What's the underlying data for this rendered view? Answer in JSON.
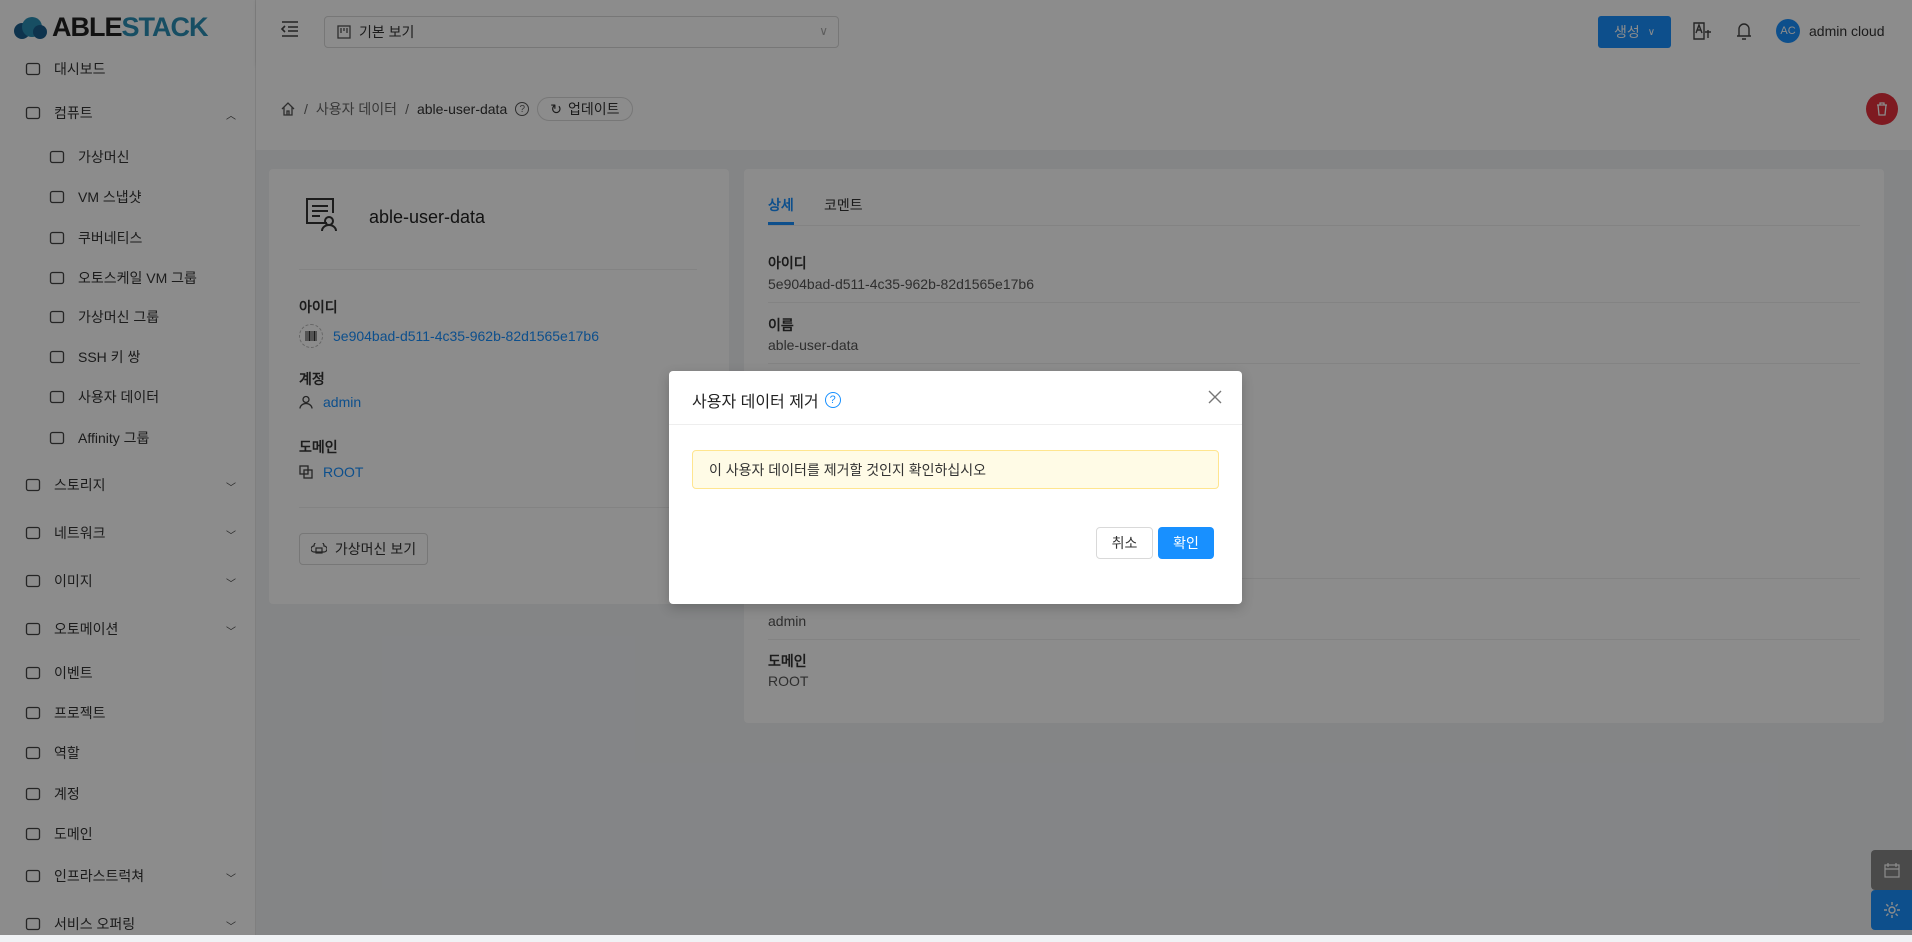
{
  "app": {
    "logo_dark": "ABLE",
    "logo_light": "STACK"
  },
  "header": {
    "view_select": "기본 보기",
    "create_label": "생성",
    "avatar_initials": "AC",
    "user_name": "admin cloud"
  },
  "sidebar": {
    "items": [
      {
        "label": "대시보드",
        "icon": "dashboard-icon"
      },
      {
        "label": "컴퓨트",
        "icon": "cloud-icon",
        "expanded": true
      },
      {
        "label": "가상머신",
        "icon": "vm-icon",
        "sub": true
      },
      {
        "label": "VM 스냅샷",
        "icon": "camera-icon",
        "sub": true
      },
      {
        "label": "쿠버네티스",
        "icon": "kubernetes-icon",
        "sub": true
      },
      {
        "label": "오토스케일 VM 그룹",
        "icon": "autoscale-icon",
        "sub": true
      },
      {
        "label": "가상머신 그룹",
        "icon": "cluster-icon",
        "sub": true
      },
      {
        "label": "SSH 키 쌍",
        "icon": "key-icon",
        "sub": true
      },
      {
        "label": "사용자 데이터",
        "icon": "userdata-icon",
        "sub": true
      },
      {
        "label": "Affinity 그룹",
        "icon": "swap-icon",
        "sub": true
      },
      {
        "label": "스토리지",
        "icon": "storage-icon"
      },
      {
        "label": "네트워크",
        "icon": "wifi-icon"
      },
      {
        "label": "이미지",
        "icon": "image-icon"
      },
      {
        "label": "오토메이션",
        "icon": "automation-icon"
      },
      {
        "label": "이벤트",
        "icon": "event-icon"
      },
      {
        "label": "프로젝트",
        "icon": "project-icon"
      },
      {
        "label": "역할",
        "icon": "role-icon"
      },
      {
        "label": "계정",
        "icon": "account-icon"
      },
      {
        "label": "도메인",
        "icon": "domain-icon"
      },
      {
        "label": "인프라스트럭쳐",
        "icon": "bank-icon"
      },
      {
        "label": "서비스 오퍼링",
        "icon": "shop-icon"
      }
    ]
  },
  "breadcrumb": {
    "section": "사용자 데이터",
    "current": "able-user-data",
    "update_label": "업데이트"
  },
  "left_card": {
    "title": "able-user-data",
    "id_label": "아이디",
    "id_value": "5e904bad-d511-4c35-962b-82d1565e17b6",
    "account_label": "계정",
    "account_value": "admin",
    "domain_label": "도메인",
    "domain_value": "ROOT",
    "view_vm_label": "가상머신 보기"
  },
  "right_card": {
    "tabs": [
      "상세",
      "코멘트"
    ],
    "id_label": "아이디",
    "id_value": "5e904bad-d511-4c35-962b-82d1565e17b6",
    "name_label": "이름",
    "name_value": "able-user-data",
    "account_value": "admin",
    "domain_label": "도메인",
    "domain_value": "ROOT"
  },
  "modal": {
    "title": "사용자 데이터 제거",
    "message": "이 사용자 데이터를 제거할 것인지 확인하십시오",
    "cancel_label": "취소",
    "ok_label": "확인"
  },
  "colors": {
    "primary": "#1890ff",
    "danger": "#e5303c",
    "warning_bg": "#fffbe6"
  }
}
